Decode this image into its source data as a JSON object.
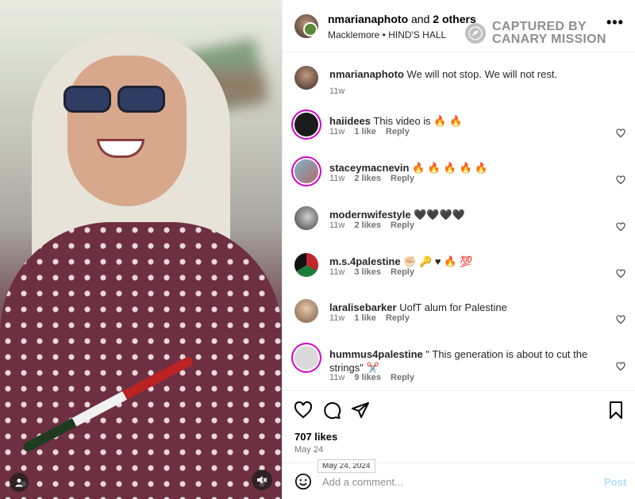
{
  "header": {
    "username": "nmarianaphoto",
    "and_text": "and",
    "others": "2 others",
    "subtitle": "Macklemore • HIND'S HALL",
    "more": "•••"
  },
  "watermark": {
    "line1": "CAPTURED BY",
    "line2": "CANARY MISSION"
  },
  "caption": {
    "username": "nmarianaphoto",
    "text": "We will not stop. We will not rest.",
    "time": "11w"
  },
  "comments": [
    {
      "username": "haiidees",
      "text": "This video is 🔥 🔥",
      "time": "11w",
      "likes": "1 like",
      "reply": "Reply"
    },
    {
      "username": "staceymacnevin",
      "text": "🔥 🔥 🔥 🔥 🔥",
      "time": "11w",
      "likes": "2 likes",
      "reply": "Reply"
    },
    {
      "username": "modernwifestyle",
      "text": "🖤🖤🖤🖤",
      "time": "11w",
      "likes": "2 likes",
      "reply": "Reply"
    },
    {
      "username": "m.s.4palestine",
      "text": "✊🏻 🔑 ♥ 🔥 💯",
      "time": "11w",
      "likes": "3 likes",
      "reply": "Reply"
    },
    {
      "username": "laralisebarker",
      "text": "UofT alum for Palestine",
      "time": "11w",
      "likes": "1 like",
      "reply": "Reply"
    },
    {
      "username": "hummus4palestine",
      "text": "\" This generation is about to cut the strings\" ✂️",
      "time": "11w",
      "likes": "9 likes",
      "reply": "Reply"
    }
  ],
  "actions": {
    "likes": "707 likes",
    "date": "May 24",
    "tooltip": "May 24, 2024"
  },
  "add_comment": {
    "placeholder": "Add a comment...",
    "post": "Post"
  }
}
